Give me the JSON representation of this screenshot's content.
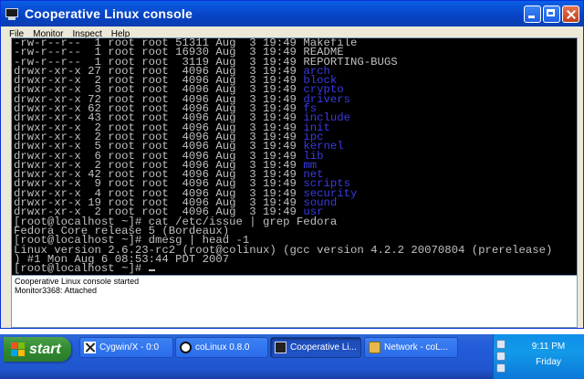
{
  "window": {
    "title": "Cooperative Linux console",
    "menu": [
      "File",
      "Monitor",
      "Inspect",
      "Help"
    ]
  },
  "terminal": {
    "listing": [
      {
        "perms": "-rw-r--r--",
        "links": "1",
        "owner": "root",
        "group": "root",
        "size": "51311",
        "month": "Aug",
        "day": "3",
        "time": "19:49",
        "name": "Makefile",
        "dir": false
      },
      {
        "perms": "-rw-r--r--",
        "links": "1",
        "owner": "root",
        "group": "root",
        "size": "16930",
        "month": "Aug",
        "day": "3",
        "time": "19:49",
        "name": "README",
        "dir": false
      },
      {
        "perms": "-rw-r--r--",
        "links": "1",
        "owner": "root",
        "group": "root",
        "size": "3119",
        "month": "Aug",
        "day": "3",
        "time": "19:49",
        "name": "REPORTING-BUGS",
        "dir": false
      },
      {
        "perms": "drwxr-xr-x",
        "links": "27",
        "owner": "root",
        "group": "root",
        "size": "4096",
        "month": "Aug",
        "day": "3",
        "time": "19:49",
        "name": "arch",
        "dir": true
      },
      {
        "perms": "drwxr-xr-x",
        "links": "2",
        "owner": "root",
        "group": "root",
        "size": "4096",
        "month": "Aug",
        "day": "3",
        "time": "19:49",
        "name": "block",
        "dir": true
      },
      {
        "perms": "drwxr-xr-x",
        "links": "3",
        "owner": "root",
        "group": "root",
        "size": "4096",
        "month": "Aug",
        "day": "3",
        "time": "19:49",
        "name": "crypto",
        "dir": true
      },
      {
        "perms": "drwxr-xr-x",
        "links": "72",
        "owner": "root",
        "group": "root",
        "size": "4096",
        "month": "Aug",
        "day": "3",
        "time": "19:49",
        "name": "drivers",
        "dir": true
      },
      {
        "perms": "drwxr-xr-x",
        "links": "62",
        "owner": "root",
        "group": "root",
        "size": "4096",
        "month": "Aug",
        "day": "3",
        "time": "19:49",
        "name": "fs",
        "dir": true
      },
      {
        "perms": "drwxr-xr-x",
        "links": "43",
        "owner": "root",
        "group": "root",
        "size": "4096",
        "month": "Aug",
        "day": "3",
        "time": "19:49",
        "name": "include",
        "dir": true
      },
      {
        "perms": "drwxr-xr-x",
        "links": "2",
        "owner": "root",
        "group": "root",
        "size": "4096",
        "month": "Aug",
        "day": "3",
        "time": "19:49",
        "name": "init",
        "dir": true
      },
      {
        "perms": "drwxr-xr-x",
        "links": "2",
        "owner": "root",
        "group": "root",
        "size": "4096",
        "month": "Aug",
        "day": "3",
        "time": "19:49",
        "name": "ipc",
        "dir": true
      },
      {
        "perms": "drwxr-xr-x",
        "links": "5",
        "owner": "root",
        "group": "root",
        "size": "4096",
        "month": "Aug",
        "day": "3",
        "time": "19:49",
        "name": "kernel",
        "dir": true
      },
      {
        "perms": "drwxr-xr-x",
        "links": "6",
        "owner": "root",
        "group": "root",
        "size": "4096",
        "month": "Aug",
        "day": "3",
        "time": "19:49",
        "name": "lib",
        "dir": true
      },
      {
        "perms": "drwxr-xr-x",
        "links": "2",
        "owner": "root",
        "group": "root",
        "size": "4096",
        "month": "Aug",
        "day": "3",
        "time": "19:49",
        "name": "mm",
        "dir": true
      },
      {
        "perms": "drwxr-xr-x",
        "links": "42",
        "owner": "root",
        "group": "root",
        "size": "4096",
        "month": "Aug",
        "day": "3",
        "time": "19:49",
        "name": "net",
        "dir": true
      },
      {
        "perms": "drwxr-xr-x",
        "links": "9",
        "owner": "root",
        "group": "root",
        "size": "4096",
        "month": "Aug",
        "day": "3",
        "time": "19:49",
        "name": "scripts",
        "dir": true
      },
      {
        "perms": "drwxr-xr-x",
        "links": "4",
        "owner": "root",
        "group": "root",
        "size": "4096",
        "month": "Aug",
        "day": "3",
        "time": "19:49",
        "name": "security",
        "dir": true
      },
      {
        "perms": "drwxr-xr-x",
        "links": "19",
        "owner": "root",
        "group": "root",
        "size": "4096",
        "month": "Aug",
        "day": "3",
        "time": "19:49",
        "name": "sound",
        "dir": true
      },
      {
        "perms": "drwxr-xr-x",
        "links": "2",
        "owner": "root",
        "group": "root",
        "size": "4096",
        "month": "Aug",
        "day": "3",
        "time": "19:49",
        "name": "usr",
        "dir": true
      }
    ],
    "after": [
      "[root@localhost ~]# cat /etc/issue | grep Fedora",
      "Fedora Core release 5 (Bordeaux)",
      "[root@localhost ~]# dmesg | head -1",
      "Linux version 2.6.23-rc2 (root@colinux) (gcc version 4.2.2 20070804 (prerelease)",
      ") #1 Mon Aug 6 08:53:44 PDT 2007"
    ],
    "prompt": "[root@localhost ~]# ",
    "colors": {
      "text": "#c0c0c0",
      "directory": "#3a3ae6",
      "background": "#000000"
    }
  },
  "log": [
    "Cooperative Linux console started",
    "Monitor3368: Attached"
  ],
  "taskbar": {
    "start_label": "start",
    "tasks": [
      {
        "label": "Cygwin/X - 0:0",
        "icon": "x-icon",
        "active": false
      },
      {
        "label": "coLinux 0.8.0",
        "icon": "colinux-icon",
        "active": false
      },
      {
        "label": "Cooperative Li...",
        "icon": "console-icon",
        "active": true
      },
      {
        "label": "Network - coL...",
        "icon": "network-icon",
        "active": false
      }
    ],
    "clock_time": "9:11 PM",
    "clock_day": "Friday"
  }
}
